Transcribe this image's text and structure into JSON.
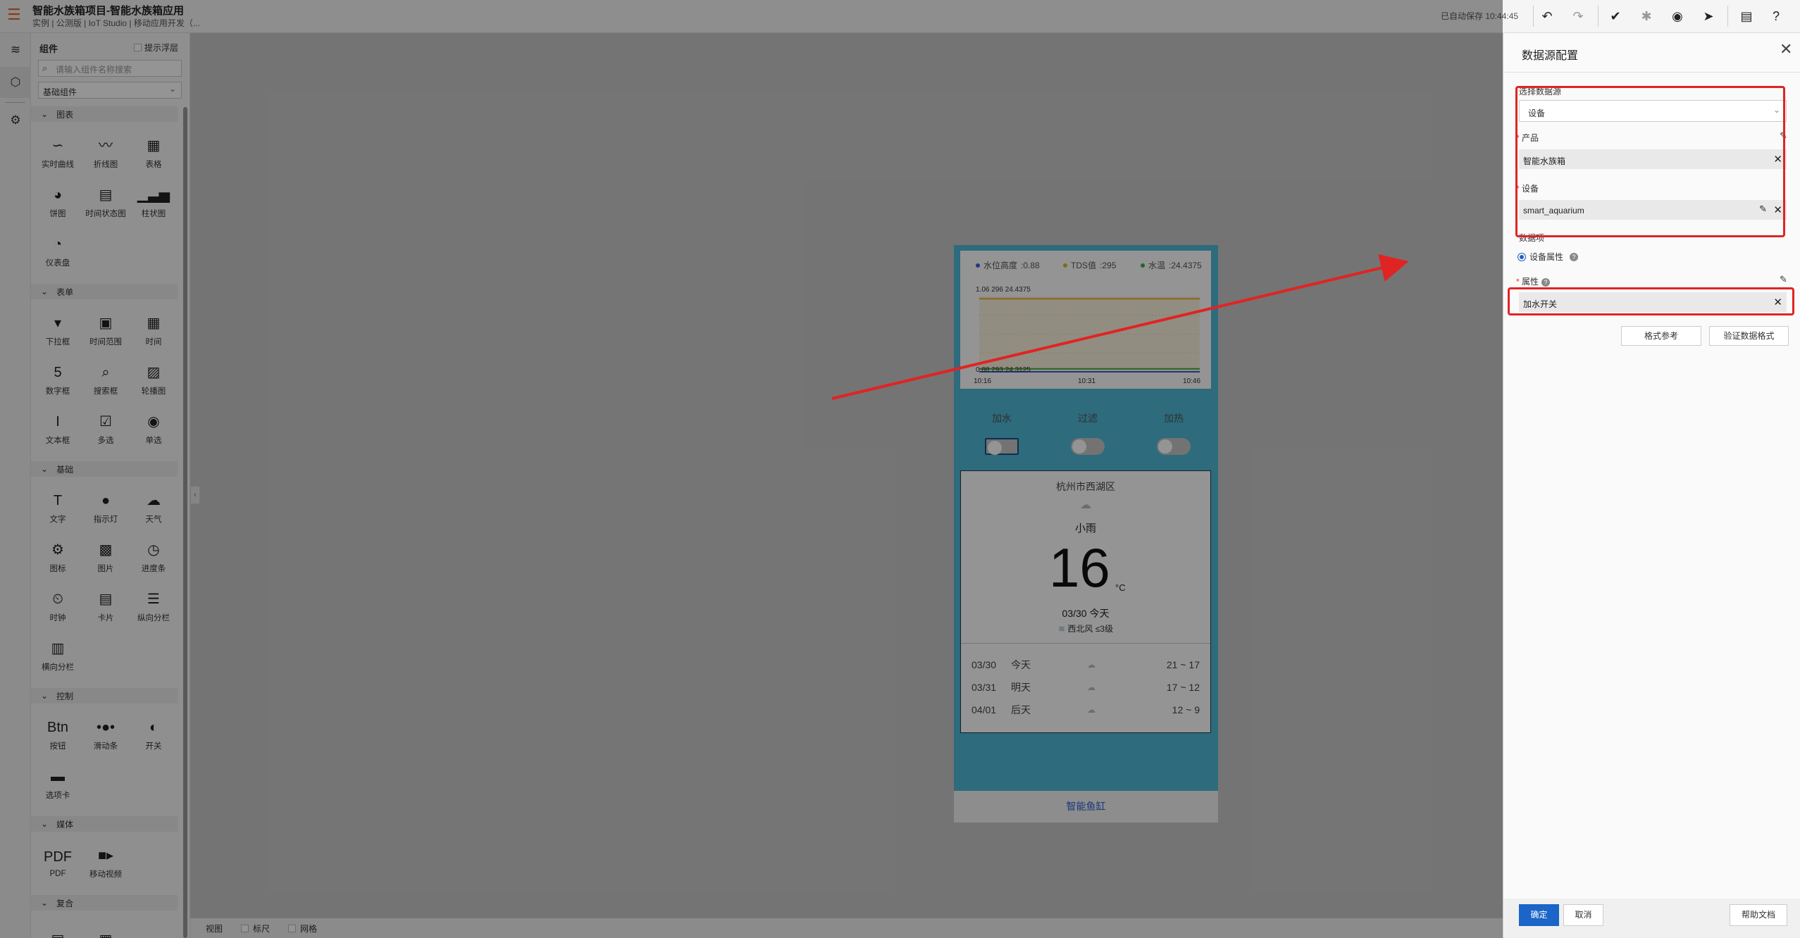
{
  "topbar": {
    "title": "智能水族箱项目-智能水族箱应用",
    "subtitle": "实例 | 公测版 | IoT Studio | 移动应用开发（...",
    "autosave": "已自动保存 10:44:45",
    "icons": [
      "undo-icon",
      "redo-icon",
      "check-circle-icon",
      "bug-icon",
      "eye-preview-icon",
      "publish-send-icon",
      "document-icon",
      "help-icon"
    ]
  },
  "rail": [
    "layers-icon",
    "components-cube-icon",
    "settings-hexagon-icon"
  ],
  "palette": {
    "title": "组件",
    "hint_label": "提示浮层",
    "search_placeholder": "请输入组件名称搜索",
    "category": "基础组件",
    "sections": [
      {
        "title": "图表",
        "items": [
          {
            "label": "实时曲线",
            "icon": "realtime-curve-icon"
          },
          {
            "label": "折线图",
            "icon": "line-chart-icon"
          },
          {
            "label": "表格",
            "icon": "table-icon"
          },
          {
            "label": "饼图",
            "icon": "pie-chart-icon"
          },
          {
            "label": "时间状态图",
            "icon": "time-status-icon"
          },
          {
            "label": "柱状图",
            "icon": "bar-chart-icon"
          },
          {
            "label": "仪表盘",
            "icon": "gauge-icon"
          }
        ]
      },
      {
        "title": "表单",
        "items": [
          {
            "label": "下拉框",
            "icon": "dropdown-icon"
          },
          {
            "label": "时间范围",
            "icon": "time-range-icon"
          },
          {
            "label": "时间",
            "icon": "calendar-icon"
          },
          {
            "label": "数字框",
            "icon": "number-box-icon"
          },
          {
            "label": "搜索框",
            "icon": "search-box-icon"
          },
          {
            "label": "轮播图",
            "icon": "carousel-icon"
          },
          {
            "label": "文本框",
            "icon": "text-input-icon"
          },
          {
            "label": "多选",
            "icon": "checkbox-icon"
          },
          {
            "label": "单选",
            "icon": "radio-icon"
          }
        ]
      },
      {
        "title": "基础",
        "items": [
          {
            "label": "文字",
            "icon": "text-icon"
          },
          {
            "label": "指示灯",
            "icon": "indicator-light-icon"
          },
          {
            "label": "天气",
            "icon": "weather-icon"
          },
          {
            "label": "图标",
            "icon": "icon-component-icon"
          },
          {
            "label": "图片",
            "icon": "image-icon"
          },
          {
            "label": "进度条",
            "icon": "progress-icon"
          },
          {
            "label": "时钟",
            "icon": "clock-icon"
          },
          {
            "label": "卡片",
            "icon": "card-icon"
          },
          {
            "label": "纵向分栏",
            "icon": "vertical-split-icon"
          },
          {
            "label": "横向分栏",
            "icon": "horizontal-split-icon"
          }
        ]
      },
      {
        "title": "控制",
        "items": [
          {
            "label": "按钮",
            "icon": "button-icon"
          },
          {
            "label": "滑动条",
            "icon": "slider-icon"
          },
          {
            "label": "开关",
            "icon": "switch-icon"
          },
          {
            "label": "选项卡",
            "icon": "tabs-icon"
          }
        ]
      },
      {
        "title": "媒体",
        "items": [
          {
            "label": "PDF",
            "icon": "pdf-icon"
          },
          {
            "label": "移动视频",
            "icon": "video-icon"
          }
        ]
      },
      {
        "title": "复合",
        "items": [
          {
            "label": "",
            "icon": "composite-card-icon"
          },
          {
            "label": "",
            "icon": "composite-grid-icon"
          }
        ]
      }
    ]
  },
  "canvas_bottom": {
    "view": "视图",
    "ruler": "标尺",
    "grid": "网格"
  },
  "phone": {
    "chart": {
      "legend": [
        {
          "name": "水位高度",
          "value": ":0.88",
          "color": "#3a5fd8"
        },
        {
          "name": "TDS值",
          "value": ":295",
          "color": "#e8b22f"
        },
        {
          "name": "水温",
          "value": ":24.4375",
          "color": "#3fae3a"
        }
      ],
      "max_label": "1.06  296  24.4375",
      "min_label": "0.88  293  24.3125",
      "x_ticks": [
        "10:16",
        "10:31",
        "10:46"
      ],
      "series_levels": {
        "tds": 0.97,
        "temp": 0.04,
        "water": 0
      }
    },
    "switches": [
      {
        "label": "加水",
        "on": false
      },
      {
        "label": "过滤",
        "on": false
      },
      {
        "label": "加热",
        "on": false
      }
    ],
    "weather": {
      "city": "杭州市西湖区",
      "condition": "小雨",
      "temp": "16",
      "unit": "°C",
      "date": "03/30 今天",
      "wind": "西北风  ≤3级",
      "forecast": [
        {
          "date": "03/30",
          "day": "今天",
          "range": "21 ~ 17"
        },
        {
          "date": "03/31",
          "day": "明天",
          "range": "17 ~ 12"
        },
        {
          "date": "04/01",
          "day": "后天",
          "range": "12 ~ 9"
        }
      ]
    },
    "footer": "智能鱼缸"
  },
  "panel": {
    "title": "数据源配置",
    "source_label": "选择数据源",
    "source_value": "设备",
    "product_label": "产品",
    "product_value": "智能水族箱",
    "device_label": "设备",
    "device_value": "smart_aquarium",
    "data_item_label": "数据项",
    "radio_label": "设备属性",
    "attr_label": "属性",
    "attr_value": "加水开关",
    "format_ref": "格式参考",
    "validate": "验证数据格式",
    "ok": "确定",
    "cancel": "取消",
    "help_doc": "帮助文档"
  }
}
